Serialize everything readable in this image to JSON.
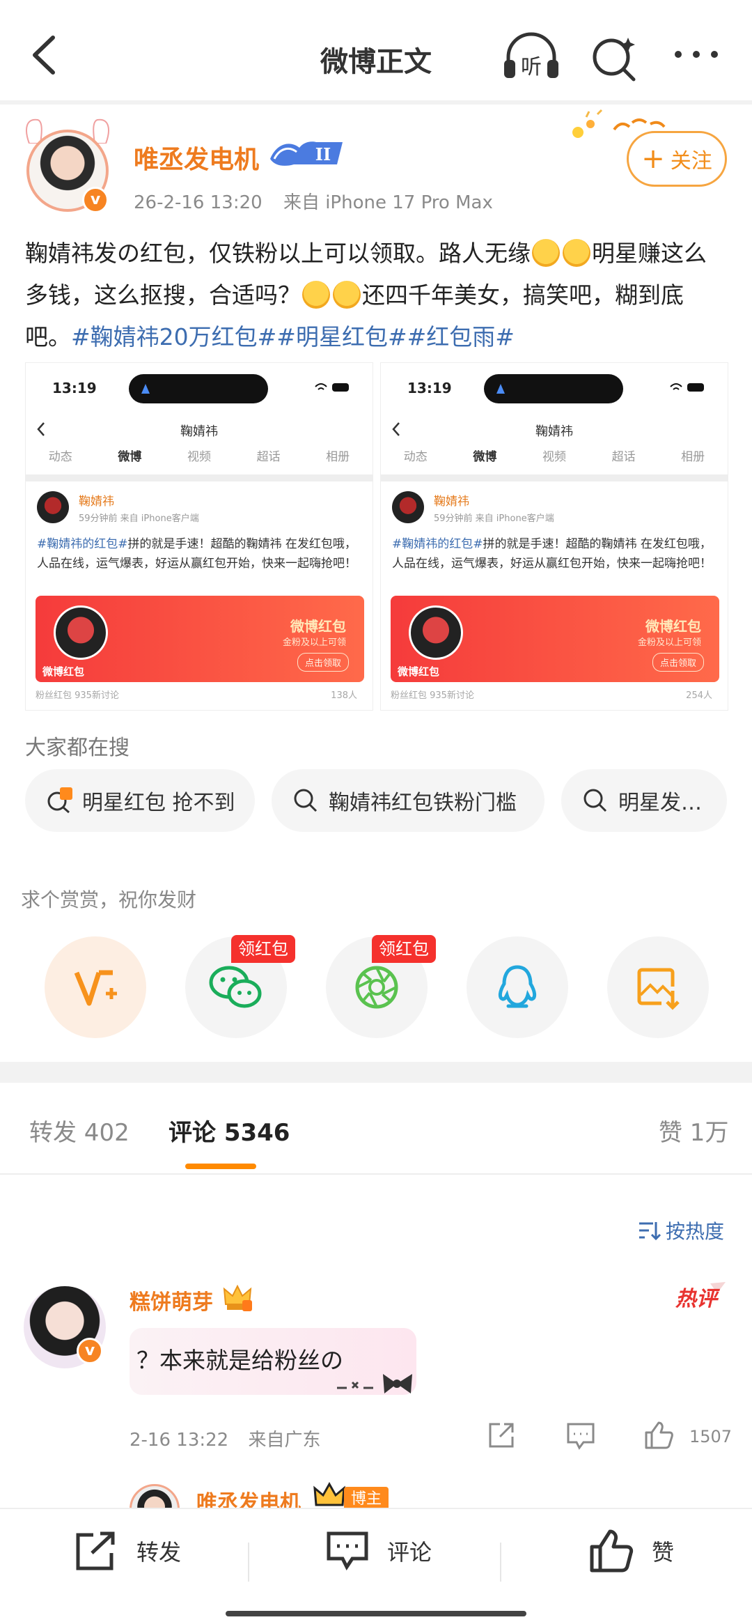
{
  "header": {
    "title": "微博正文",
    "listen_label": "听"
  },
  "author": {
    "name": "唯丞发电机",
    "level": "II",
    "time": "26-2-16 13:20",
    "source": "来自 iPhone 17 Pro Max",
    "follow_label": "关注"
  },
  "post": {
    "text_1": "鞠婧祎发の红包，仅铁粉以上可以领取。路人无缘",
    "text_2": "明星赚这么多钱，这么抠搜，合适吗？",
    "text_3": "还四千年美女，搞笑吧，糊到底吧。",
    "hashtags": [
      "#鞠婧祎20万红包#",
      "#明星红包#",
      "#红包雨#"
    ]
  },
  "images": [
    {
      "time": "13:19",
      "nav_title": "鞠婧祎",
      "tabs": [
        "动态",
        "微博",
        "视频",
        "超话",
        "相册"
      ],
      "name": "鞠婧祎",
      "meta": "59分钟前  来自 iPhone客户端",
      "hashtag": "#鞠婧祎的红包#",
      "text": "拼的就是手速！超酷的鞠婧祎 在发红包哦，人品在线，运气爆表，好运从赢红包开始，快来一起嗨抢吧！",
      "redpack_label": "微博红包",
      "redpack_title": "微博红包",
      "redpack_sub": "金粉及以上可领",
      "redpack_claim": "点击领取",
      "footer_left": "粉丝红包 935新讨论",
      "footer_right": "138人"
    },
    {
      "time": "13:19",
      "nav_title": "鞠婧祎",
      "tabs": [
        "动态",
        "微博",
        "视频",
        "超话",
        "相册"
      ],
      "name": "鞠婧祎",
      "meta": "59分钟前  来自 iPhone客户端",
      "hashtag": "#鞠婧祎的红包#",
      "text": "拼的就是手速！超酷的鞠婧祎 在发红包哦，人品在线，运气爆表，好运从赢红包开始，快来一起嗨抢吧！",
      "redpack_label": "微博红包",
      "redpack_title": "微博红包",
      "redpack_sub": "金粉及以上可领",
      "redpack_claim": "点击领取",
      "footer_left": "粉丝红包 935新讨论",
      "footer_right": "254人"
    }
  ],
  "search": {
    "title": "大家都在搜",
    "chips": [
      "明星红包 抢不到",
      "鞠婧祎红包铁粉门槛",
      "明星发…"
    ]
  },
  "reward": {
    "title": "求个赏赏，祝你发财",
    "badge_1": "领红包",
    "badge_2": "领红包"
  },
  "comment_tabs": {
    "repost": "转发 402",
    "comments": "评论 5346",
    "likes": "赞 1万"
  },
  "sort_label": "按热度",
  "comment": {
    "name": "糕饼萌芽",
    "hot_label": "热评",
    "text": "？本来就是给粉丝の",
    "time": "2-16 13:22",
    "location": "来自广东",
    "likes": "1507"
  },
  "reply": {
    "name": "唯丞发电机",
    "tag": "博主"
  },
  "bottom": {
    "repost": "转发",
    "comment": "评论",
    "like": "赞"
  },
  "colors": {
    "accent": "#ee7b1f",
    "link": "#3d6db0",
    "follow": "#f28d1a",
    "red": "#f5312d"
  }
}
